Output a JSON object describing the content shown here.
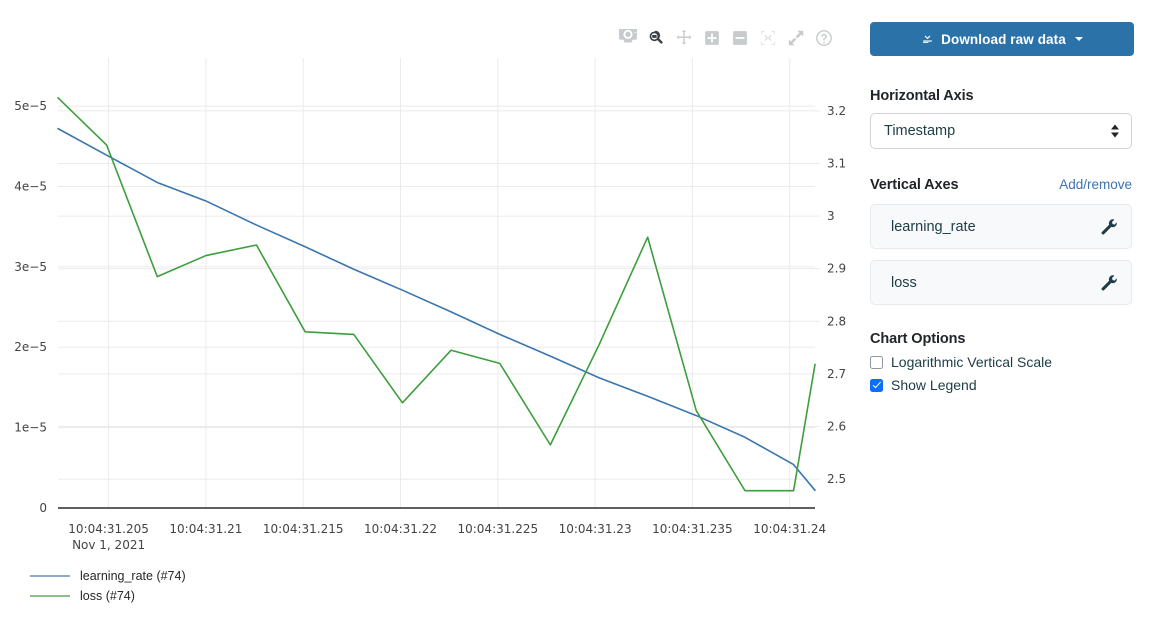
{
  "modebar": {
    "buttons": [
      {
        "name": "download-plot-icon",
        "title": "Download plot as a png",
        "state": "idle"
      },
      {
        "name": "zoom-icon",
        "title": "Zoom",
        "state": "active"
      },
      {
        "name": "pan-icon",
        "title": "Pan",
        "state": "idle"
      },
      {
        "name": "zoom-in-icon",
        "title": "Zoom in",
        "state": "idle"
      },
      {
        "name": "zoom-out-icon",
        "title": "Zoom out",
        "state": "idle"
      },
      {
        "name": "autoscale-icon",
        "title": "Autoscale",
        "state": "muted"
      },
      {
        "name": "reset-axes-icon",
        "title": "Reset axes",
        "state": "idle"
      },
      {
        "name": "help-icon",
        "title": "Produced with Plotly",
        "state": "idle"
      }
    ]
  },
  "sidebar": {
    "download_label": "Download raw data",
    "horizontal_axis_title": "Horizontal Axis",
    "horizontal_axis_value": "Timestamp",
    "horizontal_axis_options": [
      "Timestamp"
    ],
    "vertical_axes_title": "Vertical Axes",
    "add_remove_label": "Add/remove",
    "vertical_axes": [
      {
        "label": "learning_rate",
        "icon": "wrench-icon"
      },
      {
        "label": "loss",
        "icon": "wrench-icon"
      }
    ],
    "chart_options_title": "Chart Options",
    "options": [
      {
        "label": "Logarithmic Vertical Scale",
        "checked": false
      },
      {
        "label": "Show Legend",
        "checked": true
      }
    ]
  },
  "colors": {
    "learning_rate": "#3a76af",
    "loss": "#3d9e3d",
    "legend_learning_rate": "#8aabcd",
    "legend_loss": "#8dc08d",
    "accent_button": "#2a72a8",
    "link": "#3b72b0",
    "checkbox_checked": "#0d6efd",
    "grid": "#ebebeb",
    "axis_line": "#2a2a2a",
    "tick_text": "#444444"
  },
  "chart_data": {
    "type": "line",
    "title": "",
    "xlabel": "",
    "ylabel": "",
    "grid": true,
    "legend_position": "bottom-left",
    "x_axis": {
      "type": "time",
      "date_label": "Nov 1, 2021",
      "tick_labels": [
        "10:04:31.205",
        "10:04:31.21",
        "10:04:31.215",
        "10:04:31.22",
        "10:04:31.225",
        "10:04:31.23",
        "10:04:31.235",
        "10:04:31.24"
      ],
      "tick_values": [
        31.205,
        31.21,
        31.215,
        31.22,
        31.225,
        31.23,
        31.235,
        31.24
      ],
      "range": [
        31.2024,
        31.2413
      ]
    },
    "y_axis_left": {
      "name": "learning_rate",
      "tick_labels": [
        "0",
        "1e-5",
        "2e-5",
        "3e-5",
        "4e-5",
        "5e-5"
      ],
      "tick_values": [
        0,
        1e-05,
        2e-05,
        3e-05,
        4e-05,
        5e-05
      ],
      "range": [
        0,
        5.3e-05
      ],
      "side": "left"
    },
    "y_axis_right": {
      "name": "loss",
      "tick_labels": [
        "2.5",
        "2.6",
        "2.7",
        "2.8",
        "2.9",
        "3",
        "3.1",
        "3.2"
      ],
      "tick_values": [
        2.5,
        2.6,
        2.7,
        2.8,
        2.9,
        3.0,
        3.1,
        3.2
      ],
      "range": [
        2.445,
        3.255
      ],
      "side": "right"
    },
    "series": [
      {
        "name": "learning_rate (#74)",
        "legend_label": "learning_rate (#74)",
        "axis": "left",
        "color": "#3a76af",
        "x": [
          31.2024,
          31.2049,
          31.2075,
          31.21,
          31.2126,
          31.2151,
          31.2176,
          31.2201,
          31.2226,
          31.2251,
          31.2277,
          31.2302,
          31.2327,
          31.2352,
          31.2377,
          31.2402,
          31.2413
        ],
        "y": [
          4.72e-05,
          4.39e-05,
          4.05e-05,
          3.82e-05,
          3.52e-05,
          3.25e-05,
          2.97e-05,
          2.71e-05,
          2.44e-05,
          2.16e-05,
          1.89e-05,
          1.62e-05,
          1.39e-05,
          1.15e-05,
          8.8e-06,
          5.4e-06,
          2.2e-06
        ]
      },
      {
        "name": "loss (#74)",
        "legend_label": "loss (#74)",
        "axis": "right",
        "color": "#3d9e3d",
        "x": [
          31.2024,
          31.2049,
          31.2075,
          31.21,
          31.2126,
          31.2151,
          31.2176,
          31.2201,
          31.2226,
          31.2251,
          31.2277,
          31.2302,
          31.2327,
          31.2352,
          31.2377,
          31.2402,
          31.2413
        ],
        "y": [
          3.225,
          3.135,
          2.885,
          2.925,
          2.945,
          2.78,
          2.775,
          2.645,
          2.745,
          2.72,
          2.565,
          2.755,
          2.96,
          2.63,
          2.478,
          2.478,
          2.718
        ]
      }
    ]
  }
}
